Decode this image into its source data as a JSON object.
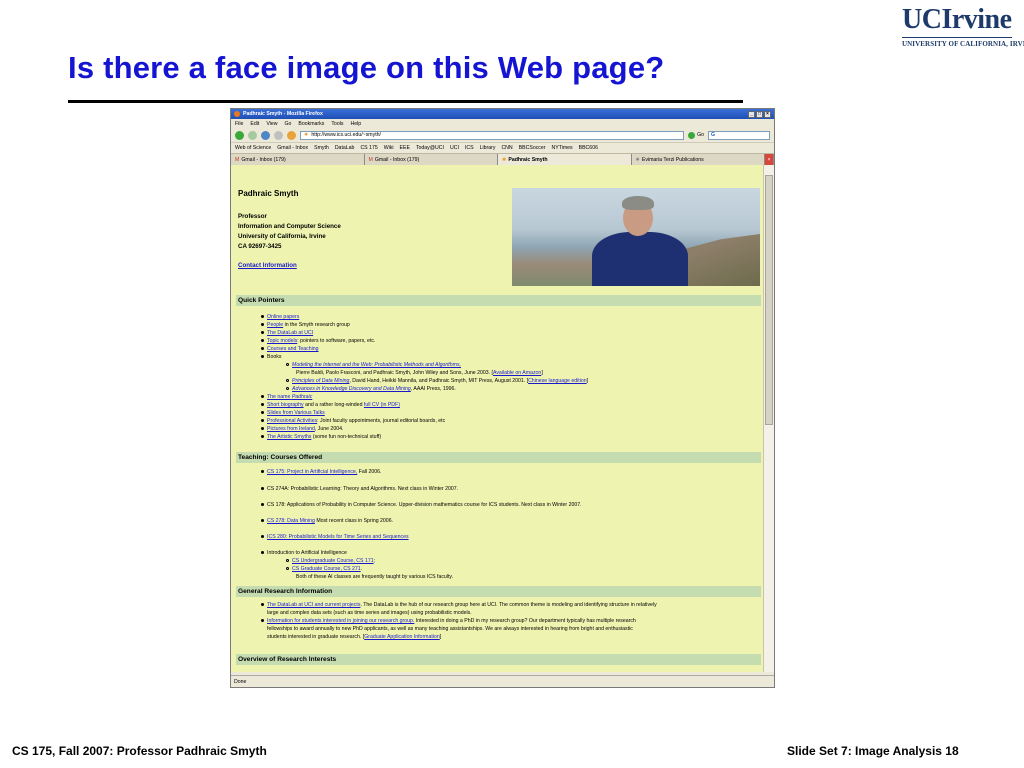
{
  "slide": {
    "title": "Is there a face image on this Web page?",
    "logo_main": "UCIrvine",
    "logo_sub": "UNIVERSITY OF CALIFORNIA, IRVINE",
    "footer_left": "CS 175, Fall 2007: Professor Padhraic Smyth",
    "footer_right": "Slide Set 7: Image Analysis 18"
  },
  "browser": {
    "window_title": "Padhraic Smyth - Mozilla Firefox",
    "menu": [
      "File",
      "Edit",
      "View",
      "Go",
      "Bookmarks",
      "Tools",
      "Help"
    ],
    "url": "http://www.ics.uci.edu/~smyth/",
    "go_label": "Go",
    "search_label": "G",
    "bookmarks": [
      "Web of Science",
      "Gmail - Inbox",
      "Smyth",
      "DataLab",
      "CS 175",
      "Wiki",
      "EEE",
      "Today@UCI",
      "UCI",
      "ICS",
      "Library",
      "CNN",
      "BBCSoccer",
      "NYTimes",
      "BBC606"
    ],
    "tabs": [
      "Gmail - Inbox (179)",
      "Gmail - Inbox (179)",
      "Padhraic Smyth",
      "Evimaria Terzi Publications"
    ],
    "status": "Done",
    "page": {
      "name": "Padhraic Smyth",
      "info": [
        "Professor",
        "Information and Computer Science",
        "University of California, Irvine",
        "CA 92697-3425"
      ],
      "contact": "Contact Information",
      "quick_heading": "Quick Pointers",
      "quick": {
        "online": "Online papers",
        "people": "People",
        "people_rest": " in the Smyth research group",
        "datalab": "The DataLab at UCI",
        "topic": "Topic models",
        "topic_rest": ": pointers to software, papers, etc.",
        "courses": "Courses and Teaching",
        "books": "Books",
        "book1": "Modeling the Internet and the Web: Probabilistic Methods and Algorithms,",
        "book1_rest": "Pierre Baldi, Paolo Frasconi, and Padhraic Smyth, John Wiley and Sons, June 2003. [",
        "book1_link": "Available on Amazon",
        "book1_end": "]",
        "book2": "Principles of Data Mining",
        "book2_rest": ", David Hand, Heikki Mannila, and Padhraic Smyth, MIT Press, August 2001. [",
        "book2_link": "Chinese language edition",
        "book2_end": "]",
        "book3": "Advances in Knowledge Discovery and Data Mining",
        "book3_rest": ", AAAI Press, 1996.",
        "name_pre": "The name ",
        "name_it": "Padhraic",
        "bio": "Short biography",
        "bio_rest": " and a rather long-winded ",
        "cv": "full CV (in PDF)",
        "slides": "Slides from Various Talks",
        "prof": "Professional Activities",
        "prof_rest": ": Joint faculty appointments, journal editorial boards, etc",
        "pics": "Pictures from Ireland",
        "pics_rest": ", June 2004.",
        "art": "The Artistic Smyths",
        "art_rest": " (some fun non-technical stuff)"
      },
      "teaching_heading": "Teaching: Courses Offered",
      "teaching": {
        "cs175": "CS 175: Project in Artificial Intelligence,",
        "cs175_rest": " Fall 2006.",
        "cs274": "CS 274A: Probabilistic Learning: Theory and Algorithms. Next class in Winter 2007.",
        "cs178": "CS 178: Applications of Probability in Computer Science. Upper-division mathematics course for ICS students. Next class in Winter 2007.",
        "cs278": "CS 278: Data Mining",
        "cs278_rest": " Most recent class in Spring 2006.",
        "ics280": "ICS 280: Probabilistic Models for Time Series and Sequences",
        "intro": "Introduction to Artificial Intelligence",
        "ug": "CS Undergraduate Course, CS 171",
        "ug_end": ";",
        "grad": "CS Graduate Course, CS 271",
        "grad_end": ".",
        "both": "Both of these AI classes are frequently taught by various ICS faculty."
      },
      "research_heading": "General Research Information",
      "research": {
        "dl": "The DataLab at UCI and current projects",
        "dl_rest": ". The DataLab is the hub of our research group here at UCI. The common theme is modeling and identifying structure in relatively",
        "dl_line2": "large and complex data sets (such as time series and images) using probabilistic models.",
        "info": "Information for students interested in joining our research group.",
        "info_rest": " Interested in doing a PhD in my research group? Our department typically has multiple research",
        "info_line2": "fellowships to award annually to new PhD applicants, as well as many teaching assistantships. We are always interested in hearing from bright and enthusiastic",
        "info_line3": "students interested in graduate research. [",
        "gradapp": "Graduate Application Information",
        "gradapp_end": "]"
      },
      "overview_heading": "Overview of Research Interests"
    }
  },
  "colors": {
    "title": "#1414d2",
    "logo": "#1e3a6a",
    "page_bg": "#eef4b0",
    "section_bg": "#c5dcb0",
    "link": "#1a1acc"
  }
}
